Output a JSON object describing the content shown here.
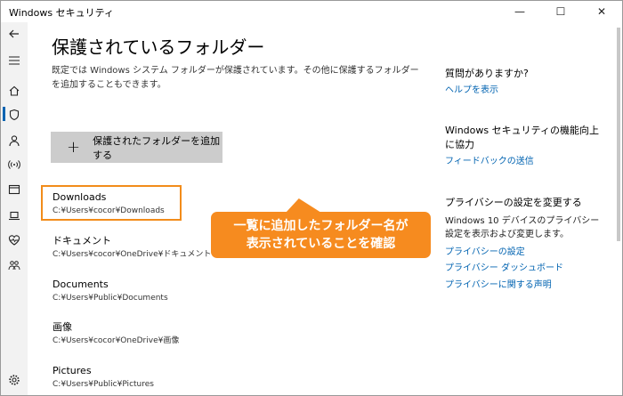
{
  "window": {
    "title": "Windows セキュリティ",
    "minimize": "—",
    "maximize": "☐",
    "close": "✕"
  },
  "sidebar": {
    "items": [
      {
        "icon": "back-arrow-icon"
      },
      {
        "icon": "hamburger-menu-icon"
      },
      {
        "icon": "home-icon"
      },
      {
        "icon": "shield-icon",
        "active": true
      },
      {
        "icon": "account-icon"
      },
      {
        "icon": "wifi-antenna-icon"
      },
      {
        "icon": "app-browser-icon"
      },
      {
        "icon": "laptop-icon"
      },
      {
        "icon": "heart-icon"
      },
      {
        "icon": "family-icon"
      },
      {
        "icon": "gear-icon"
      }
    ]
  },
  "main": {
    "title": "保護されているフォルダー",
    "description": "既定では Windows システム フォルダーが保護されています。その他に保護するフォルダーを追加することもできます。",
    "add_button": {
      "icon": "plus-icon",
      "label": "保護されたフォルダーを追加する"
    },
    "folders": [
      {
        "name": "Downloads",
        "path": "C:¥Users¥cocor¥Downloads"
      },
      {
        "name": "ドキュメント",
        "path": "C:¥Users¥cocor¥OneDrive¥ドキュメント"
      },
      {
        "name": "Documents",
        "path": "C:¥Users¥Public¥Documents"
      },
      {
        "name": "画像",
        "path": "C:¥Users¥cocor¥OneDrive¥画像"
      },
      {
        "name": "Pictures",
        "path": "C:¥Users¥Public¥Pictures"
      }
    ]
  },
  "callout": {
    "line1": "一覧に追加したフォルダー名が",
    "line2": "表示されていることを確認",
    "color": "#f68b1f"
  },
  "right_panel": {
    "questions_heading": "質問がありますか?",
    "help_link": "ヘルプを表示",
    "improve_heading": "Windows セキュリティの機能向上に協力",
    "feedback_link": "フィードバックの送信",
    "privacy_heading": "プライバシーの設定を変更する",
    "privacy_text": "Windows 10 デバイスのプライバシー設定を表示および変更します。",
    "privacy_links": [
      "プライバシーの設定",
      "プライバシー ダッシュボード",
      "プライバシーに関する声明"
    ]
  },
  "colors": {
    "accent": "#0063b1",
    "highlight_border": "#f28c1a",
    "button_bg": "#cccccc"
  }
}
